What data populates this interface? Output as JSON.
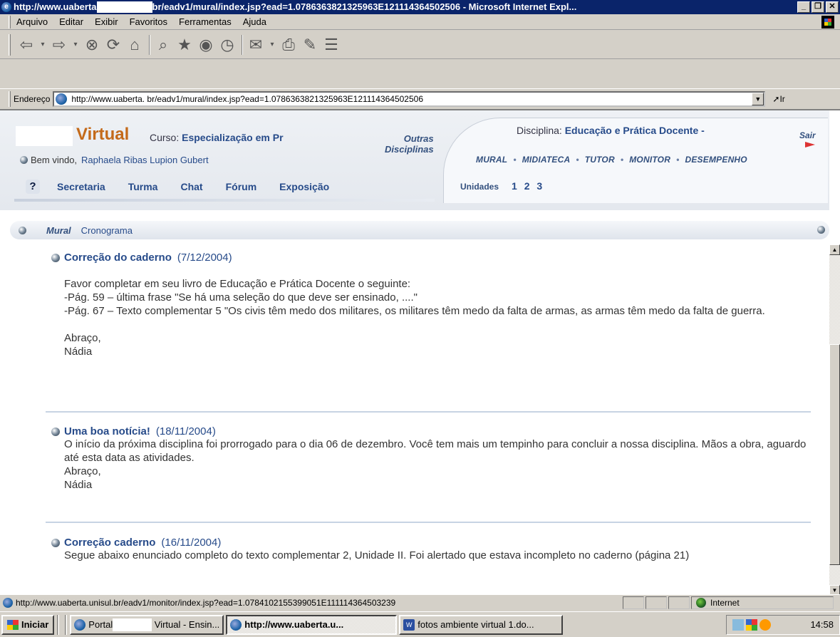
{
  "window": {
    "title_prefix": "http://www.uaberta",
    "title_suffix": "br/eadv1/mural/index.jsp?ead=1.0786363821325963E121114364502506 - Microsoft Internet Expl...",
    "min": "_",
    "max": "❐",
    "close": "✕"
  },
  "menu": [
    "Arquivo",
    "Editar",
    "Exibir",
    "Favoritos",
    "Ferramentas",
    "Ajuda"
  ],
  "address": {
    "label": "Endereço",
    "value": "http://www.uaberta.         br/eadv1/mural/index.jsp?ead=1.0786363821325963E121114364502506",
    "go": "Ir"
  },
  "site": {
    "brand": "Virtual",
    "curso_label": "Curso:",
    "curso_value": "Especialização em Pr",
    "bemvindo_label": "Bem vindo,",
    "user": "Raphaela Ribas Lupion Gubert",
    "outras": "Outras",
    "disciplinas": "Disciplinas",
    "disciplina_label": "Disciplina:",
    "disciplina_value": "Educação e Prática Docente -",
    "sair": "Sair",
    "right_nav": [
      "MURAL",
      "MIDIATECA",
      "TUTOR",
      "MONITOR",
      "DESEMPENHO"
    ],
    "help": "?",
    "left_nav": [
      "Secretaria",
      "Turma",
      "Chat",
      "Fórum",
      "Exposição"
    ],
    "unidades_label": "Unidades",
    "unidades_nums": "1 2 3"
  },
  "subnav": {
    "mural": "Mural",
    "cronograma": "Cronograma"
  },
  "posts": [
    {
      "title": "Correção do caderno",
      "date": "(7/12/2004)",
      "body": "\nFavor completar em seu livro de Educação e Prática Docente o seguinte:\n-Pág. 59 – última frase \"Se há uma seleção do que deve ser ensinado, ....\"\n-Pág. 67 – Texto complementar 5 \"Os civis têm medo dos militares, os militares têm medo da falta de armas, as armas têm medo da falta de guerra.\n\nAbraço,\nNádia"
    },
    {
      "title": "Uma boa notícia!",
      "date": "(18/11/2004)",
      "body": "O início da próxima disciplina foi prorrogado para o dia 06 de dezembro. Você tem mais um tempinho para concluir a nossa disciplina. Mãos a obra, aguardo até esta data as atividades.\nAbraço,\nNádia"
    },
    {
      "title": "Correção caderno",
      "date": "(16/11/2004)",
      "body": "Segue abaixo enunciado completo do texto complementar 2, Unidade II. Foi alertado que estava incompleto no caderno (página 21)"
    }
  ],
  "status": {
    "url": "http://www.uaberta.unisul.br/eadv1/monitor/index.jsp?ead=1.0784102155399051E111114364503239",
    "zone": "Internet"
  },
  "taskbar": {
    "start": "Iniciar",
    "items": [
      {
        "pre": "Portal",
        "post": "Virtual - Ensin..."
      },
      {
        "label": "http://www.uaberta.u..."
      },
      {
        "label": "fotos ambiente virtual 1.do..."
      }
    ],
    "clock": "14:58"
  }
}
